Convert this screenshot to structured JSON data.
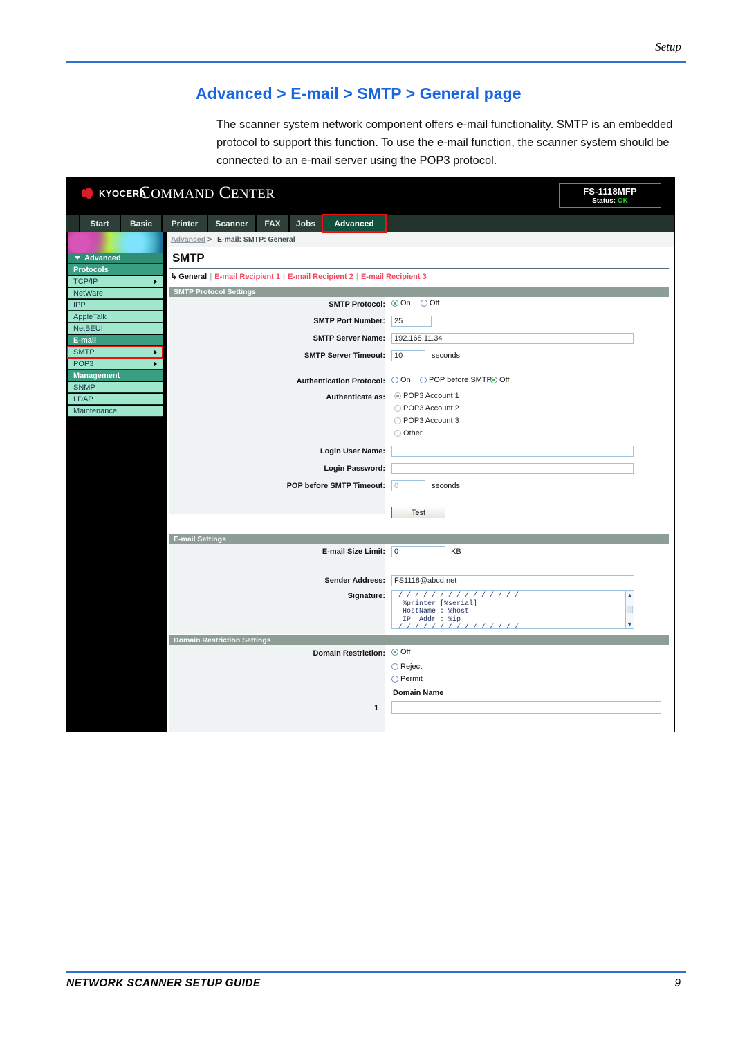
{
  "page": {
    "header_label": "Setup",
    "title": "Advanced > E-mail > SMTP > General page",
    "body": "The scanner system network component offers e-mail functionality. SMTP is an embedded protocol to support this function. To use the e-mail function, the scanner system should be connected to an e-mail server using the POP3 protocol.",
    "footer_left": "NETWORK SCANNER SETUP GUIDE",
    "footer_right": "9",
    "rule_color": "#2f6fd0",
    "title_color": "#1a66e0"
  },
  "app": {
    "brand_mark": "kyocera-logo-icon",
    "brand_word": "KYOCERA",
    "product_word_1": "C",
    "product_word_1b": "OMMAND",
    "product_word_2": "C",
    "product_word_2b": "ENTER",
    "status": {
      "model": "FS-1118MFP",
      "status_label": "Status:",
      "status_value": "OK",
      "status_color": "#27d427"
    },
    "tabs": [
      {
        "label": "Start",
        "active": false
      },
      {
        "label": "Basic",
        "active": false
      },
      {
        "label": "Printer",
        "active": false
      },
      {
        "label": "Scanner",
        "active": false
      },
      {
        "label": "FAX",
        "active": false
      },
      {
        "label": "Jobs",
        "active": false
      },
      {
        "label": "Advanced",
        "active": true
      }
    ],
    "breadcrumb": {
      "root": "Advanced",
      "separator": ">",
      "current": "E-mail: SMTP: General"
    },
    "sidebar": {
      "top": "Advanced",
      "items": [
        {
          "label": "Protocols",
          "type": "head",
          "arrow": false
        },
        {
          "label": "TCP/IP",
          "type": "link",
          "arrow": true
        },
        {
          "label": "NetWare",
          "type": "link",
          "arrow": false
        },
        {
          "label": "IPP",
          "type": "link",
          "arrow": false
        },
        {
          "label": "AppleTalk",
          "type": "link",
          "arrow": false
        },
        {
          "label": "NetBEUI",
          "type": "link",
          "arrow": false
        },
        {
          "label": "E-mail",
          "type": "head",
          "arrow": false
        },
        {
          "label": "SMTP",
          "type": "link",
          "arrow": true,
          "selected": true
        },
        {
          "label": "POP3",
          "type": "link",
          "arrow": true
        },
        {
          "label": "Management",
          "type": "head",
          "arrow": false
        },
        {
          "label": "SNMP",
          "type": "link",
          "arrow": false
        },
        {
          "label": "LDAP",
          "type": "link",
          "arrow": false
        },
        {
          "label": "Maintenance",
          "type": "link",
          "arrow": false
        }
      ]
    },
    "pane": {
      "title": "SMTP",
      "subnav": {
        "current": "General",
        "links": [
          "E-mail Recipient 1",
          "E-mail Recipient 2",
          "E-mail Recipient 3"
        ],
        "separator": "|"
      },
      "sections": {
        "smtp": {
          "header": "SMTP Protocol Settings",
          "protocol_label": "SMTP Protocol:",
          "protocol_options": [
            "On",
            "Off"
          ],
          "protocol_selected": "On",
          "port_label": "SMTP Port Number:",
          "port_value": "25",
          "server_label": "SMTP Server Name:",
          "server_value": "192.168.11.34",
          "timeout_label": "SMTP Server Timeout:",
          "timeout_value": "10",
          "timeout_unit": "seconds",
          "auth_label": "Authentication Protocol:",
          "auth_options": [
            "On",
            "POP before SMTP",
            "Off"
          ],
          "auth_selected": "Off",
          "authas_label": "Authenticate as:",
          "authas_options": [
            "POP3 Account 1",
            "POP3 Account 2",
            "POP3 Account 3",
            "Other"
          ],
          "authas_selected": "POP3 Account 1",
          "user_label": "Login User Name:",
          "user_value": "",
          "pass_label": "Login Password:",
          "pass_value": "",
          "pop_timeout_label": "POP before SMTP Timeout:",
          "pop_timeout_value": "0",
          "pop_timeout_unit": "seconds",
          "test_button": "Test"
        },
        "email": {
          "header": "E-mail Settings",
          "size_label": "E-mail Size Limit:",
          "size_value": "0",
          "size_unit": "KB",
          "sender_label": "Sender Address:",
          "sender_value": "FS1118@abcd.net",
          "signature_label": "Signature:",
          "signature_value": "_/_/_/_/_/_/_/_/_/_/_/_/_/_/_/\n  %printer [%serial]\n  HostName : %host\n  IP  Addr : %ip\n_/_/_/_/_/_/_/_/_/_/_/_/_/_/_/"
        },
        "domain": {
          "header": "Domain Restriction Settings",
          "restriction_label": "Domain Restriction:",
          "restriction_options": [
            "Off",
            "Reject",
            "Permit"
          ],
          "restriction_selected": "Off",
          "domain_name_header": "Domain Name",
          "rows": [
            {
              "num": "1",
              "value": ""
            }
          ]
        }
      }
    }
  }
}
